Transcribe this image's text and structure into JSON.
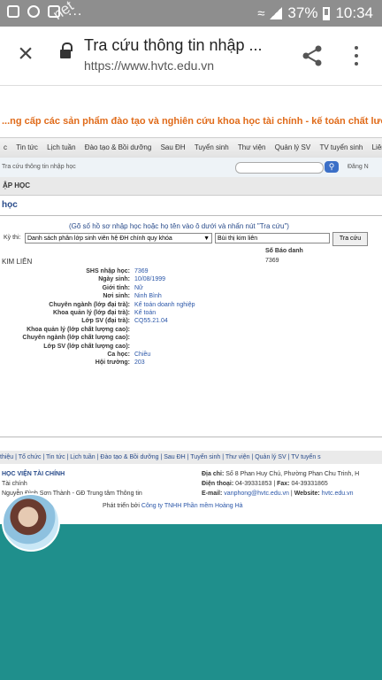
{
  "statusbar": {
    "left_dots": "...",
    "battery_text": "37%",
    "time": "10:34",
    "watermark": "net"
  },
  "chrome": {
    "title": "Tra cứu thông tin nhập ...",
    "url": "https://www.hvtc.edu.vn"
  },
  "banner": {
    "text": "...ng cấp các sản phẩm đào tạo và nghiên cứu khoa học tài chính - kế toán chất lượng cao ch"
  },
  "nav": {
    "items": [
      "c",
      "Tin tức",
      "Lịch tuần",
      "Đào tạo & Bồi dưỡng",
      "Sau ĐH",
      "Tuyển sinh",
      "Thư viện",
      "Quản lý SV",
      "TV tuyển sinh",
      "Liên"
    ]
  },
  "crumb": {
    "text": "Tra cứu thông tin nhập học",
    "login": "Đăng N"
  },
  "section": {
    "title": "ẬP HỌC"
  },
  "page": {
    "heading": "học",
    "hint": "(Gõ số hồ sơ nhập học hoặc họ tên vào ô dưới và nhấn nút \"Tra cứu\")"
  },
  "form": {
    "label": "Kỳ thi:",
    "select_value": "Danh sách phân lớp sinh viên hệ ĐH chính quy khóa",
    "input_value": "Bùi thị kim liên",
    "button": "Tra cứu"
  },
  "result": {
    "sbd_header": "Số Báo danh",
    "sbd_value": "7369",
    "name": "KIM LIÊN",
    "rows": [
      {
        "k": "SHS nhập học:",
        "v": "7369"
      },
      {
        "k": "Ngày sinh:",
        "v": "10/08/1999"
      },
      {
        "k": "Giới tính:",
        "v": "Nữ"
      },
      {
        "k": "Nơi sinh:",
        "v": "Ninh Bình"
      },
      {
        "k": "Chuyên ngành (lớp đại trà):",
        "v": "Kế toán doanh nghiệp"
      },
      {
        "k": "Khoa quản lý (lớp đại trà):",
        "v": "Kế toán"
      },
      {
        "k": "Lớp SV (đại trà):",
        "v": "CQ55.21.04"
      },
      {
        "k": "Khoa quản lý (lớp chất lượng cao):",
        "v": ""
      },
      {
        "k": "Chuyên ngành (lớp chất lượng cao):",
        "v": ""
      },
      {
        "k": "Lớp SV (lớp chất lượng cao):",
        "v": ""
      },
      {
        "k": "Ca học:",
        "v": "Chiều"
      },
      {
        "k": "Hội trường:",
        "v": "203"
      }
    ]
  },
  "footer_nav": {
    "text": "thiệu | Tổ chức | Tin tức | Lịch tuần | Đào tạo & Bồi dưỡng | Sau ĐH | Tuyển sinh | Thư viện | Quản lý SV | TV tuyển s"
  },
  "footer": {
    "org": "HỌC VIỆN TÀI CHÍNH",
    "line2": "Tài chính",
    "line3": "Nguyễn Đình Sơn Thành - GĐ Trung tâm Thông tin",
    "addr_label": "Địa chỉ:",
    "addr": "Số 8 Phan Huy Chú, Phường Phan Chu Trinh, H",
    "phone_label": "Điện thoại:",
    "phone": "04-39331853",
    "fax_label": "Fax:",
    "fax": "04-39331865",
    "email_label": "E-mail:",
    "email": "vanphong@hvtc.edu.vn",
    "web_label": "Website:",
    "web": "hvtc.edu.vn",
    "dev_prefix": "Phát triển bởi",
    "dev_link": "Công ty TNHH Phần mềm Hoàng Hà"
  }
}
